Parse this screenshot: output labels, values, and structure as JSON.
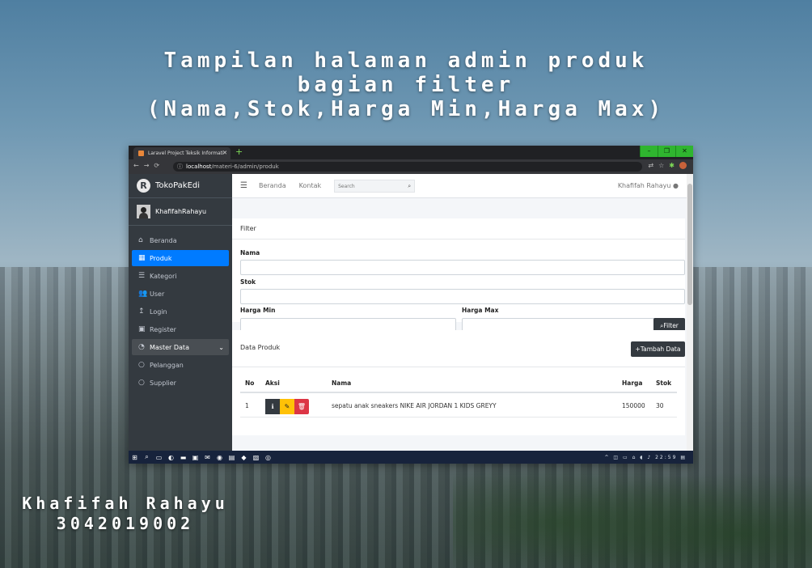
{
  "headline": {
    "line1": "Tampilan halaman admin produk",
    "line2": "bagian filter",
    "line3": "(Nama,Stok,Harga Min,Harga Max)"
  },
  "author": {
    "name": "Khafifah Rahayu",
    "id": "3042019002"
  },
  "browser": {
    "tab_title": "Laravel Project Teksik Informati",
    "url_host": "localhost",
    "url_path": "/materi-6/admin/produk",
    "window_buttons": [
      "–",
      "❐",
      "✕"
    ]
  },
  "sidebar": {
    "brand": "TokoPakEdi",
    "user": "KhafifahRahayu",
    "items": [
      {
        "label": "Beranda",
        "icon": "home-icon",
        "glyph": "⌂"
      },
      {
        "label": "Produk",
        "icon": "grid-icon",
        "glyph": "▦"
      },
      {
        "label": "Kategori",
        "icon": "list-icon",
        "glyph": "☰"
      },
      {
        "label": "User",
        "icon": "users-icon",
        "glyph": "👥"
      },
      {
        "label": "Login",
        "icon": "login-icon",
        "glyph": "↥"
      },
      {
        "label": "Register",
        "icon": "register-icon",
        "glyph": "▣"
      },
      {
        "label": "Master Data",
        "icon": "dashboard-icon",
        "glyph": "◔"
      },
      {
        "label": "Pelanggan",
        "icon": "circle-icon",
        "glyph": "○"
      },
      {
        "label": "Supplier",
        "icon": "circle-icon",
        "glyph": "○"
      }
    ]
  },
  "topnav": {
    "links": [
      "Beranda",
      "Kontak"
    ],
    "search_placeholder": "Search",
    "user": "Khafifah Rahayu"
  },
  "filter": {
    "title": "Filter",
    "nama_label": "Nama",
    "stok_label": "Stok",
    "harga_min_label": "Harga Min",
    "harga_max_label": "Harga Max",
    "button": "Filter"
  },
  "data_produk": {
    "title": "Data Produk",
    "add_button": "Tambah Data",
    "columns": [
      "No",
      "Aksi",
      "Nama",
      "Harga",
      "Stok"
    ],
    "rows": [
      {
        "no": "1",
        "nama": "sepatu anak sneakers NIKE AIR JORDAN 1 KIDS GREYY",
        "harga": "150000",
        "stok": "30"
      }
    ]
  },
  "taskbar": {
    "time": "22:59"
  },
  "colors": {
    "sidebar": "#343a40",
    "active": "#007bff",
    "info": "#343a40",
    "edit": "#ffc107",
    "delete": "#dc3545"
  }
}
